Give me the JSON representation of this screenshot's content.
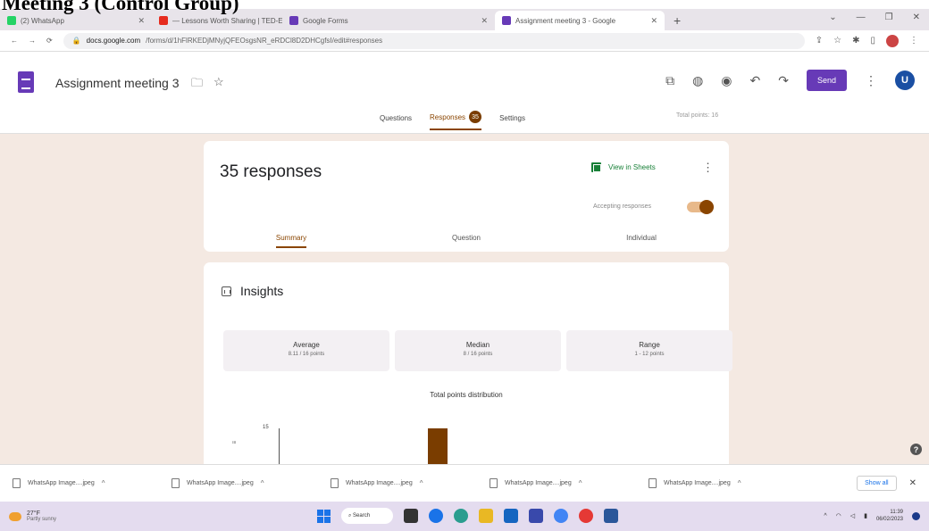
{
  "doc_heading": "Meeting 3 (Control Group)",
  "browser": {
    "tabs": [
      {
        "label": "(2) WhatsApp",
        "color": "#25d366",
        "active": false
      },
      {
        "label": "— Lessons Worth Sharing | TED-Ed",
        "color": "#e62b1e",
        "active": false
      },
      {
        "label": "Google Forms",
        "color": "#673ab7",
        "active": false
      },
      {
        "label": "Assignment meeting 3 - Google",
        "color": "#673ab7",
        "active": true
      }
    ],
    "new_tab": "+",
    "url_host": "docs.google.com",
    "url_path": "/forms/d/1hFlRKEDjMNyjQFEOsgsNR_eRDCl8D2DHCgfsI/edit#responses"
  },
  "form": {
    "title": "Assignment meeting 3",
    "send_label": "Send",
    "avatar_letter": "U",
    "nav": {
      "questions": "Questions",
      "responses": "Responses",
      "responses_count": "35",
      "settings": "Settings"
    },
    "total_points": "Total points: 16"
  },
  "responses": {
    "count_label": "35 responses",
    "view_sheets": "View in Sheets",
    "accepting": "Accepting responses",
    "accepting_on": true,
    "sub_tabs": {
      "summary": "Summary",
      "question": "Question",
      "individual": "Individual"
    }
  },
  "insights": {
    "title": "Insights",
    "stats": [
      {
        "label": "Average",
        "value": "8.11 / 16 points"
      },
      {
        "label": "Median",
        "value": "8 / 16 points"
      },
      {
        "label": "Range",
        "value": "1 - 12 points"
      }
    ],
    "distribution_title": "Total points distribution",
    "y_tick": "15"
  },
  "downloads": {
    "items": [
      "WhatsApp Image....jpeg",
      "WhatsApp Image....jpeg",
      "WhatsApp Image....jpeg",
      "WhatsApp Image....jpeg",
      "WhatsApp Image....jpeg"
    ],
    "show_all": "Show all"
  },
  "taskbar": {
    "weather_temp": "27°F",
    "weather_desc": "Partly sunny",
    "search": "Search",
    "time": "11:39",
    "date": "06/02/2023"
  },
  "colors": {
    "accent": "#8a4500",
    "forms_purple": "#673ab7",
    "background": "#f4e9e2"
  }
}
